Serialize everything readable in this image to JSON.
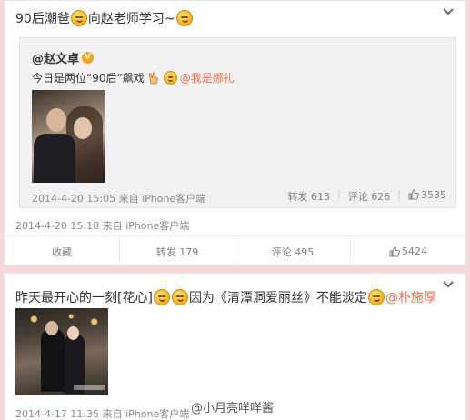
{
  "post1": {
    "text_part1": "90后潮爸",
    "text_part2": "向赵老师学习~",
    "quote": {
      "author": "@赵文卓",
      "verified_badge": "V",
      "text": "今日是两位“90后”飙戏",
      "hand_icon": "victory-hand-icon",
      "mention": "@我是娜扎",
      "timestamp": "2014-4-20 15:05",
      "source": "来自 iPhone客户端",
      "repost_label": "转发 613",
      "comment_label": "评论 626",
      "like_count": "3535"
    },
    "timestamp": "2014-4-20 15:18",
    "source": "来自 iPhone客户端",
    "actions": {
      "favorite": "收藏",
      "repost": "转发 179",
      "comment": "评论 495",
      "like": "5424"
    }
  },
  "post2": {
    "text_part1": "昨天最开心的一刻[花心]",
    "text_part2": "因为《清潭洞爱丽丝》不能淡定",
    "mention": "@朴施厚",
    "timestamp": "2014-4-17 11:35",
    "source": "来自 iPhone客户端"
  },
  "watermark": "@小月亮咩咩酱",
  "colors": {
    "page_background": "#f4d8da",
    "link": "#eb7350",
    "meta_text": "#8a8a8a",
    "quote_background": "#f2f2f5"
  },
  "icons": [
    "chevron-down-icon",
    "grin-emoji-icon",
    "verified-badge-icon",
    "victory-hand-icon",
    "thumb-up-icon"
  ]
}
